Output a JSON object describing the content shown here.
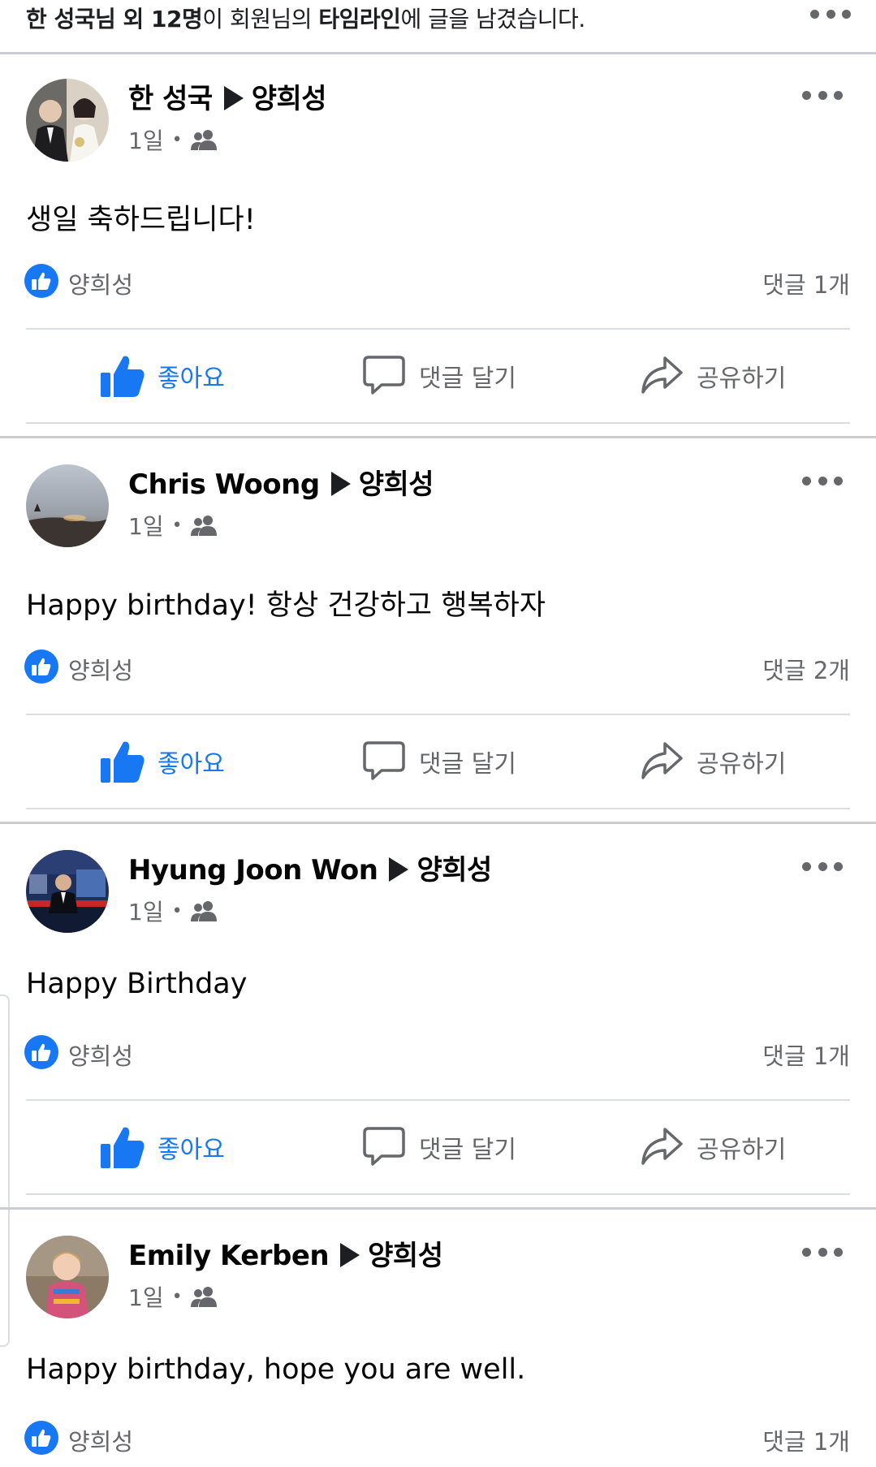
{
  "notification": {
    "text_parts": [
      {
        "text": "한 성국님 외 12명",
        "bold": true
      },
      {
        "text": "이 회원님의 ",
        "bold": false
      },
      {
        "text": "타임라인",
        "bold": true
      },
      {
        "text": "에 글을 남겼습니다.",
        "bold": false
      }
    ]
  },
  "actions": {
    "like": "좋아요",
    "comment": "댓글 달기",
    "share": "공유하기"
  },
  "colors": {
    "accent": "#1877f2",
    "secondary_text": "#65676b",
    "divider": "#dadde1"
  },
  "posts": [
    {
      "author": "한 성국",
      "target": "양희성",
      "time": "1일",
      "audience_icon": "friends-icon",
      "text": "생일 축하드립니다!",
      "liker": "양희성",
      "comments": "댓글 1개"
    },
    {
      "author": "Chris Woong",
      "target": "양희성",
      "time": "1일",
      "audience_icon": "friends-icon",
      "text": "Happy birthday! 항상 건강하고 행복하자",
      "liker": "양희성",
      "comments": "댓글 2개"
    },
    {
      "author": "Hyung Joon Won",
      "target": "양희성",
      "time": "1일",
      "audience_icon": "friends-icon",
      "text": "Happy Birthday",
      "liker": "양희성",
      "comments": "댓글 1개"
    },
    {
      "author": "Emily Kerben",
      "target": "양희성",
      "time": "1일",
      "audience_icon": "friends-icon",
      "text": "Happy birthday, hope you are well.",
      "liker": "양희성",
      "comments": "댓글 1개"
    }
  ]
}
